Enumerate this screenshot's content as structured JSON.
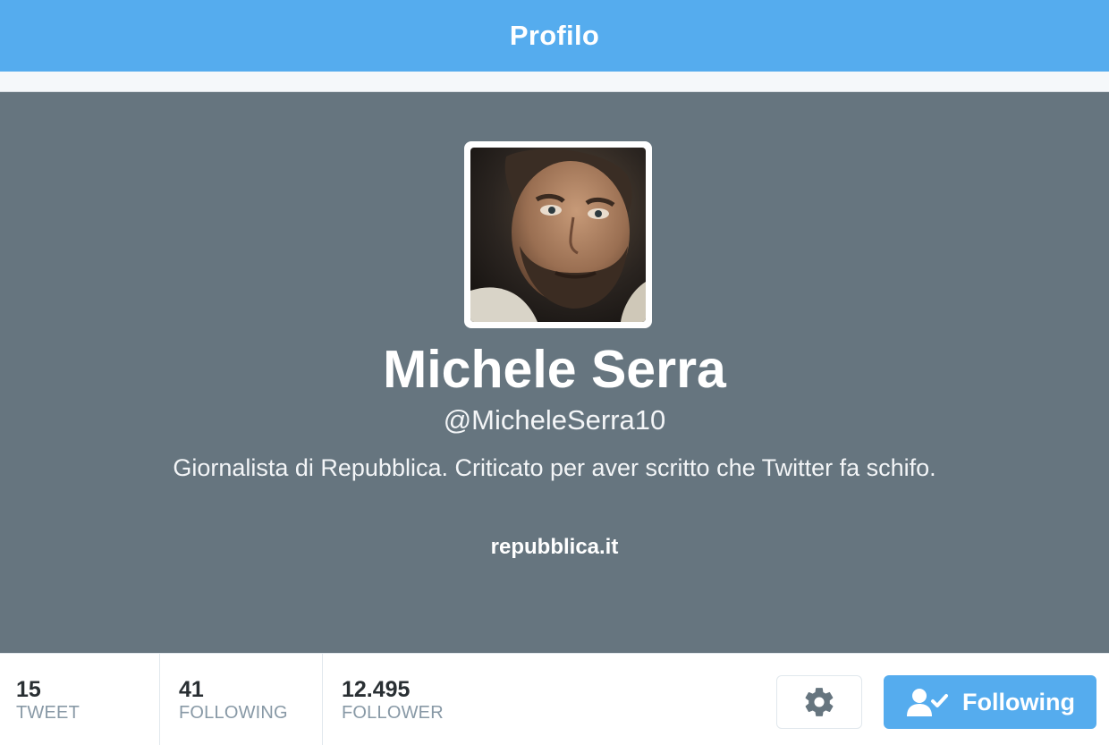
{
  "navbar": {
    "title": "Profilo"
  },
  "profile": {
    "name": "Michele Serra",
    "handle": "@MicheleSerra10",
    "bio": "Giornalista di Repubblica. Criticato per aver scritto che Twitter fa schifo.",
    "url": "repubblica.it",
    "avatar_alt": "Michele Serra"
  },
  "stats": [
    {
      "value": "15",
      "label": "TWEET"
    },
    {
      "value": "41",
      "label": "FOLLOWING"
    },
    {
      "value": "12.495",
      "label": "FOLLOWER"
    }
  ],
  "actions": {
    "settings_icon": "gear-icon",
    "following_label": "Following",
    "following_icon": "user-check-icon"
  },
  "colors": {
    "accent": "#55acee",
    "header_bg": "#66757f",
    "stat_label": "#8899a6",
    "stat_value": "#292f33"
  }
}
